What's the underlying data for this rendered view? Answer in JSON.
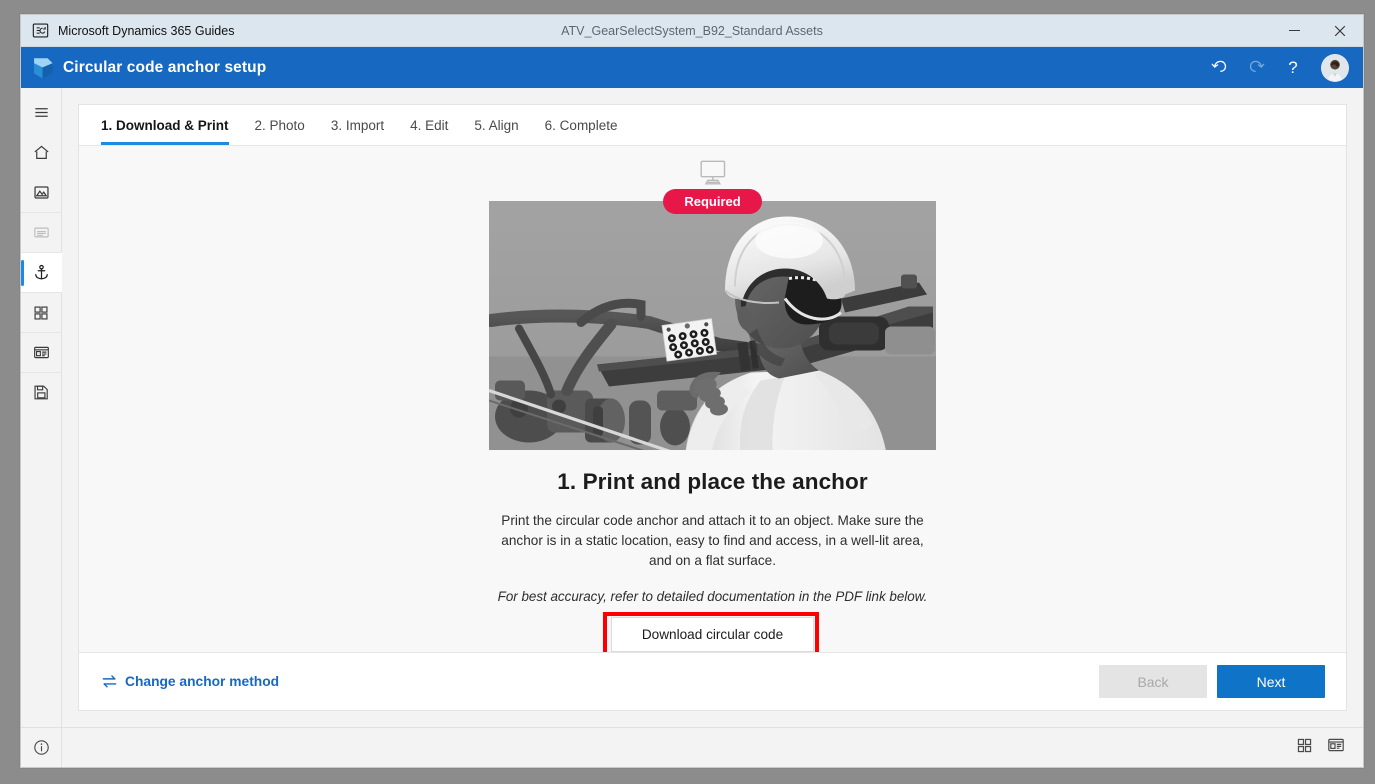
{
  "titlebar": {
    "app_icon": "guides-app-icon",
    "app_name": "Microsoft Dynamics 365 Guides",
    "document_title": "ATV_GearSelectSystem_B92_Standard Assets",
    "minimize_label": "–",
    "close_label": "✕"
  },
  "appbar": {
    "logo_icon": "dynamics-365-logo",
    "title": "Circular code anchor setup",
    "undo_icon": "undo-icon",
    "redo_icon": "redo-icon",
    "help_icon": "help-question-icon",
    "help_label": "?",
    "avatar_icon": "user-avatar"
  },
  "sidebar": {
    "items": [
      {
        "name": "menu-hamburger",
        "icon": "hamburger-icon",
        "state": "default"
      },
      {
        "name": "home",
        "icon": "home-icon",
        "state": "default"
      },
      {
        "name": "media",
        "icon": "image-icon",
        "state": "default"
      },
      {
        "name": "steps",
        "icon": "text-lines-icon",
        "state": "disabled"
      },
      {
        "name": "anchor",
        "icon": "anchor-icon",
        "state": "active"
      },
      {
        "name": "apps-grid",
        "icon": "grid-icon",
        "state": "default"
      },
      {
        "name": "card-layout",
        "icon": "card-layout-icon",
        "state": "default"
      },
      {
        "name": "save",
        "icon": "save-icon",
        "state": "default"
      }
    ]
  },
  "tabs": [
    {
      "label": "1. Download & Print",
      "active": true
    },
    {
      "label": "2. Photo",
      "active": false
    },
    {
      "label": "3. Import",
      "active": false
    },
    {
      "label": "4. Edit",
      "active": false
    },
    {
      "label": "5. Align",
      "active": false
    },
    {
      "label": "6. Complete",
      "active": false
    }
  ],
  "panel": {
    "platform_icon": "desktop-monitor-icon",
    "badge": "Required",
    "badge_color": "#e8174a",
    "hero_image_alt": "Worker in hard hat placing a printed circular code anchor card on a vehicle frame",
    "heading": "1. Print and place the anchor",
    "description": "Print the circular code anchor and attach it to an object. Make sure the anchor is in a static location, easy to find and access, in a well-lit area, and on a flat surface.",
    "note": "For best accuracy, refer to detailed documentation in the PDF link below.",
    "download_button": "Download circular code",
    "highlight_color": "#ff0000"
  },
  "footer": {
    "change_method_icon": "swap-arrows-icon",
    "change_method_label": "Change anchor method",
    "back_label": "Back",
    "next_label": "Next",
    "next_color": "#0f74c8"
  },
  "statusbar": {
    "info_icon": "info-circle-icon",
    "grid_icon": "grid-view-icon",
    "card_icon": "card-view-icon"
  }
}
